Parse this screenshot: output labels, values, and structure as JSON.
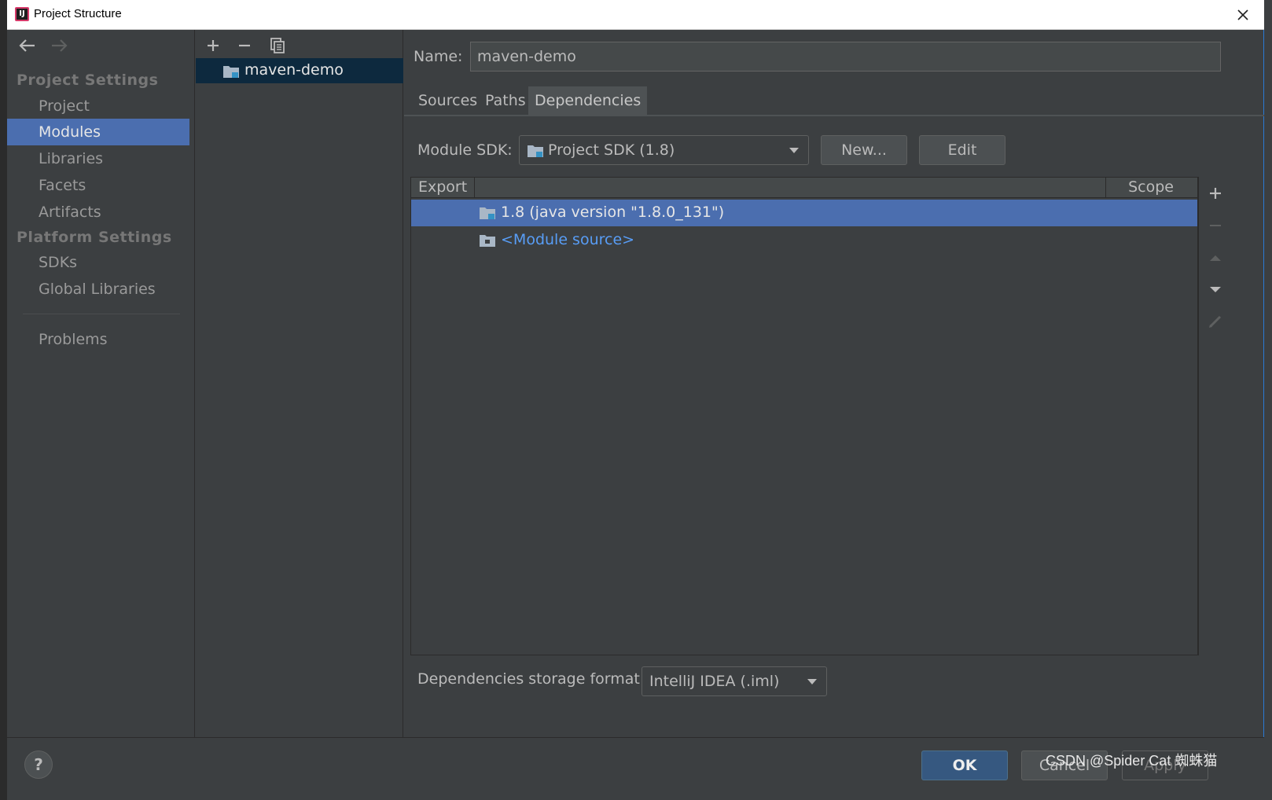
{
  "window": {
    "title": "Project Structure"
  },
  "nav": {
    "project_settings": "Project Settings",
    "project_items": [
      "Project",
      "Modules",
      "Libraries",
      "Facets",
      "Artifacts"
    ],
    "platform_settings": "Platform Settings",
    "platform_items": [
      "SDKs",
      "Global Libraries"
    ],
    "problems": "Problems",
    "selected": "Modules"
  },
  "tree": {
    "module_name": "maven-demo"
  },
  "module": {
    "name_label": "Name:",
    "name_value": "maven-demo",
    "tabs": [
      "Sources",
      "Paths",
      "Dependencies"
    ],
    "active_tab": "Dependencies",
    "sdk_label": "Module SDK:",
    "sdk_value": "Project SDK (1.8)",
    "new_button": "New...",
    "edit_button": "Edit"
  },
  "dependencies": {
    "columns": [
      "Export",
      "Scope"
    ],
    "rows": [
      {
        "label": "1.8 (java version \"1.8.0_131\")",
        "selected": true
      },
      {
        "label": "<Module source>",
        "selected": false
      }
    ]
  },
  "storage": {
    "label": "Dependencies storage format:",
    "value": "IntelliJ IDEA (.iml)"
  },
  "footer": {
    "help": "?",
    "ok": "OK",
    "cancel": "Cancel",
    "apply": "Apply"
  },
  "watermark": "CSDN @Spider Cat 蜘蛛猫",
  "colors": {
    "background": "#3c3f41",
    "selection": "#4b6eaf",
    "tree_selection": "#0d293e",
    "link": "#589df6",
    "ok_button": "#365880"
  }
}
